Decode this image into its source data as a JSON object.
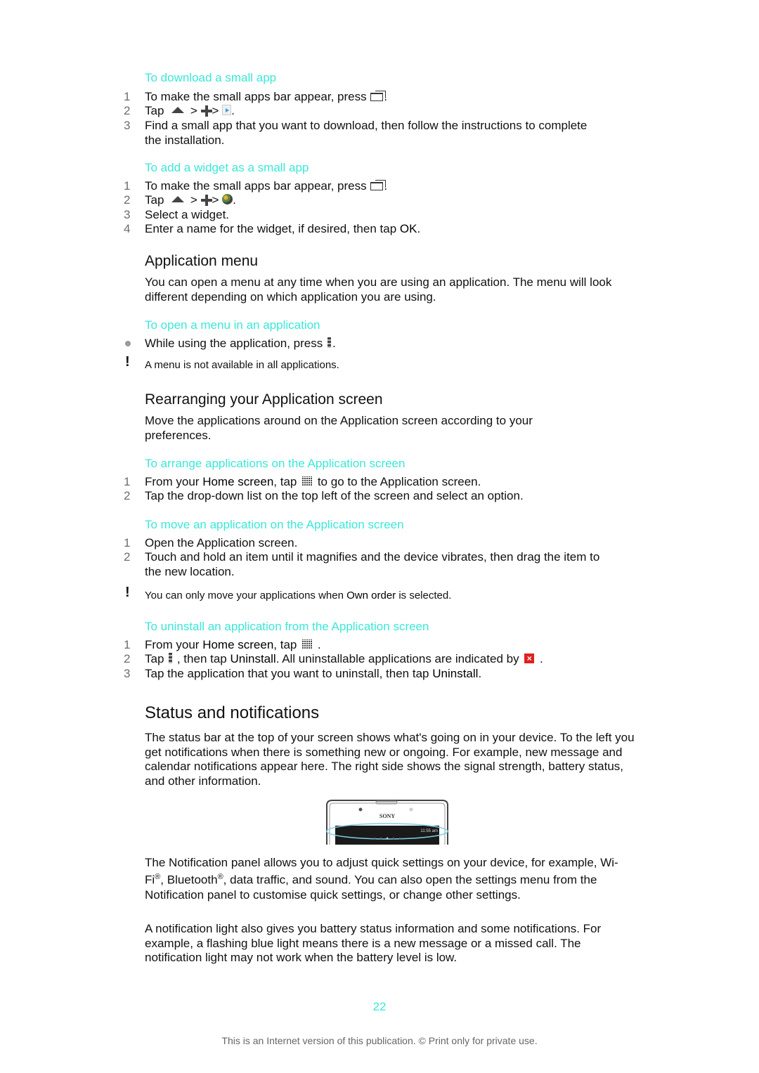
{
  "sections": {
    "download_small_app": {
      "title": "To download a small app",
      "steps": [
        {
          "num": "1",
          "text_before": "To make the small apps bar appear, press ",
          "text_after": "."
        },
        {
          "num": "2",
          "text_before": "Tap ",
          "sep1": " > ",
          "sep2": "> ",
          "text_after": "."
        },
        {
          "num": "3",
          "text": "Find a small app that you want to download, then follow the instructions to complete the installation."
        }
      ]
    },
    "add_widget": {
      "title": "To add a widget as a small app",
      "steps": [
        {
          "num": "1",
          "text_before": "To make the small apps bar appear, press ",
          "text_after": "."
        },
        {
          "num": "2",
          "text_before": "Tap ",
          "sep1": " > ",
          "sep2": "> ",
          "text_after": "."
        },
        {
          "num": "3",
          "text": "Select a widget."
        },
        {
          "num": "4",
          "text_before": "Enter a name for the widget, if desired, then tap ",
          "bold": "OK",
          "text_after": "."
        }
      ]
    },
    "application_menu": {
      "heading": "Application menu",
      "paragraph": "You can open a menu at any time when you are using an application. The menu will look different depending on which application you are using.",
      "proc_title": "To open a menu in an application",
      "bullet_before": "While using the application, press ",
      "bullet_after": ".",
      "note": "A menu is not available in all applications."
    },
    "rearranging": {
      "heading": "Rearranging your Application screen",
      "paragraph": "Move the applications around on the Application screen according to your preferences.",
      "arrange": {
        "title": "To arrange applications on the Application screen",
        "steps": [
          {
            "num": "1",
            "text_before": "From your ",
            "bold": "Home screen",
            "text_mid": ", tap ",
            "text_after": " to go to the Application screen."
          },
          {
            "num": "2",
            "text": "Tap the drop-down list on the top left of the screen and select an option."
          }
        ]
      },
      "move": {
        "title": "To move an application on the Application screen",
        "steps": [
          {
            "num": "1",
            "text": "Open the Application screen."
          },
          {
            "num": "2",
            "text": "Touch and hold an item until it magnifies and the device vibrates, then drag the item to the new location."
          }
        ],
        "note_before": "You can only move your applications when ",
        "note_bold": "Own order",
        "note_after": " is selected."
      },
      "uninstall": {
        "title": "To uninstall an application from the Application screen",
        "steps": [
          {
            "num": "1",
            "text_before": "From your ",
            "bold": "Home screen",
            "text_mid": ", tap ",
            "text_after": " ."
          },
          {
            "num": "2",
            "text_before": "Tap ",
            "text_mid": " , then tap ",
            "bold": "Uninstall",
            "text_mid2": ". All uninstallable applications are indicated by ",
            "text_after": " ."
          },
          {
            "num": "3",
            "text_before": "Tap the application that you want to uninstall, then tap ",
            "bold": "Uninstall",
            "text_after": "."
          }
        ]
      }
    },
    "status": {
      "heading": "Status and notifications",
      "paragraph1": "The status bar at the top of your screen shows what's going on in your device. To the left you get notifications when there is something new or ongoing. For example, new message and calendar notifications appear here. The right side shows the signal strength, battery status, and other information.",
      "phone_brand": "SONY",
      "phone_time": "11:55 am",
      "p2_part1": "The Notification panel allows you to adjust quick settings on your device, for example, Wi-Fi",
      "p2_reg": "®",
      "p2_part2": ", Bluetooth",
      "p2_part3": ", data traffic, and sound. You can also open the settings menu from the Notification panel to customise quick settings, or change other settings.",
      "paragraph3": "A notification light also gives you battery status information and some notifications. For example, a flashing blue light means there is a new message or a missed call. The notification light may not work when the battery level is low."
    }
  },
  "page_number": "22",
  "footer": "This is an Internet version of this publication. © Print only for private use.",
  "colors": {
    "accent": "#3be8d8",
    "text": "#111111",
    "step_number": "#6d6d6d",
    "uninstall_badge": "#e02020"
  }
}
